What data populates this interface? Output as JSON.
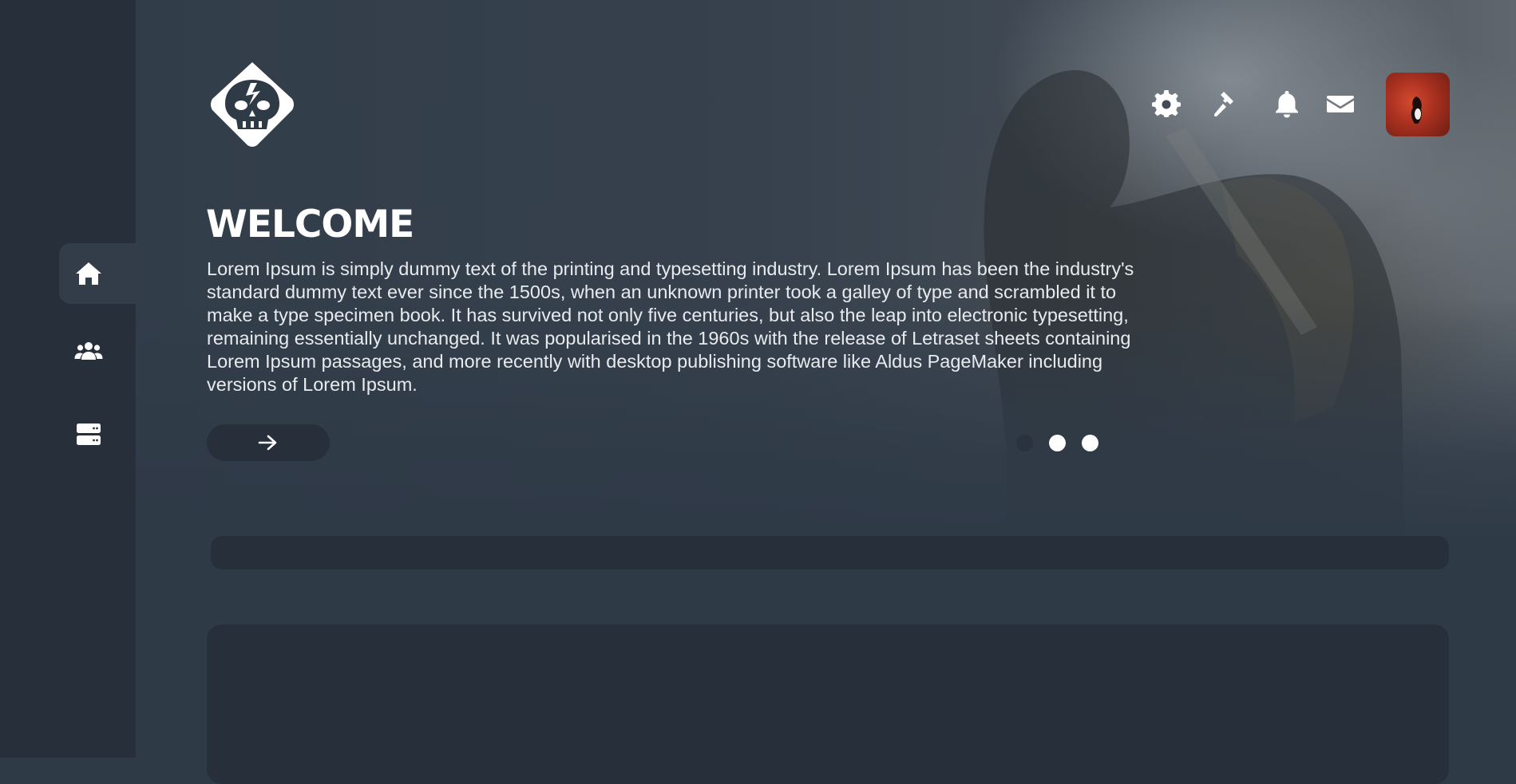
{
  "hero": {
    "title": "WELCOME",
    "description": "Lorem Ipsum is simply dummy text of the printing and typesetting industry. Lorem Ipsum has been the industry's standard dummy text ever since the 1500s, when an unknown printer took a galley of type and scrambled it to make a type specimen book. It has survived not only five centuries, but also the leap into electronic typesetting, remaining essentially unchanged. It was popularised in the 1960s with the release of Letraset sheets containing Lorem Ipsum passages, and more recently with desktop publishing software like Aldus PageMaker including versions of Lorem Ipsum.",
    "next_button_icon": "arrow-right-icon",
    "carousel": {
      "slide_count": 3,
      "active_index": 0
    }
  },
  "sidebar": {
    "items": [
      {
        "icon": "home-icon",
        "active": true
      },
      {
        "icon": "users-icon",
        "active": false
      },
      {
        "icon": "server-icon",
        "active": false
      }
    ]
  },
  "header": {
    "logo_icon": "skull-logo-icon",
    "icons": [
      "gear-icon",
      "hammer-icon",
      "bell-icon",
      "envelope-icon"
    ],
    "avatar": "avatar"
  },
  "colors": {
    "background": "#2f3a47",
    "sidebar": "#27303a",
    "active_item": "#323d49",
    "text": "#ffffff"
  }
}
